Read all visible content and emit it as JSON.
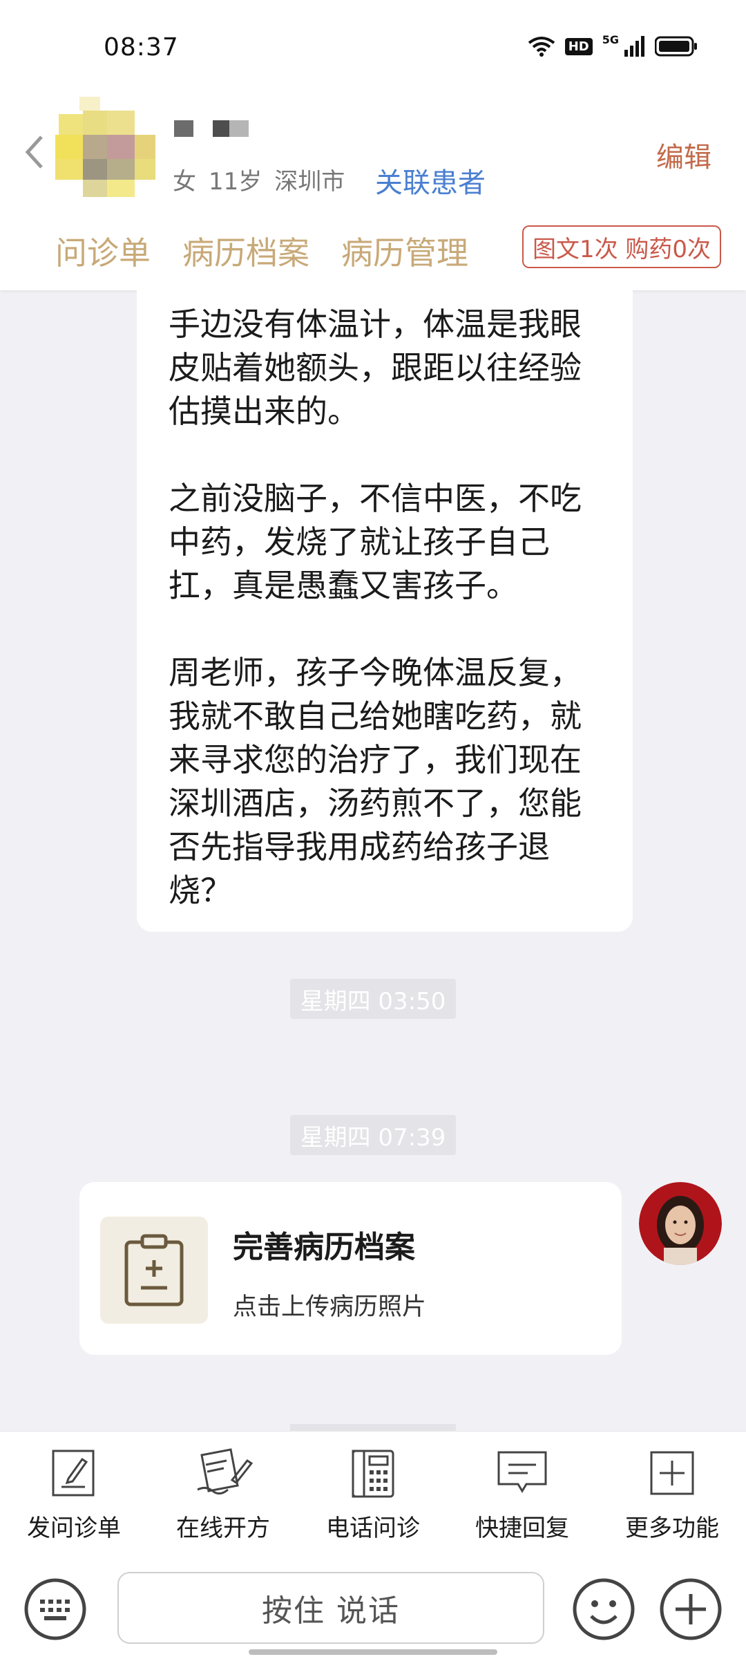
{
  "status_bar": {
    "time": "08:37",
    "hd": "HD",
    "network": "5G"
  },
  "header": {
    "gender": "女",
    "age": "11岁",
    "city": "深圳市",
    "link_patient": "关联患者",
    "edit": "编辑",
    "tabs": [
      "问诊单",
      "病历档案",
      "病历管理"
    ],
    "usage_badge": "图文1次 购药0次"
  },
  "chat": {
    "patient_message": [
      "手边没有体温计，体温是我眼皮贴着她额头，跟距以往经验估摸出来的。",
      "之前没脑子，不信中医，不吃中药，发烧了就让孩子自己扛，真是愚蠢又害孩子。",
      "周老师，孩子今晚体温反复，我就不敢自己给她瞎吃药，就来寻求您的治疗了，我们现在深圳酒店，汤药煎不了，您能否先指导我用成药给孩子退烧？"
    ],
    "timestamps": [
      "星期四 03:50",
      "星期四 07:39"
    ],
    "card": {
      "title": "完善病历档案",
      "subtitle": "点击上传病历照片"
    }
  },
  "toolbar": {
    "items": [
      {
        "label": "发问诊单",
        "icon": "form-pen-icon"
      },
      {
        "label": "在线开方",
        "icon": "prescription-icon"
      },
      {
        "label": "电话问诊",
        "icon": "phone-icon"
      },
      {
        "label": "快捷回复",
        "icon": "quick-reply-icon"
      },
      {
        "label": "更多功能",
        "icon": "more-plus-icon"
      }
    ]
  },
  "input": {
    "voice_button": "按住 说话"
  },
  "colors": {
    "accent_gold": "#c8a978",
    "link_blue": "#4a7fd1",
    "edit_red": "#c26a4a",
    "badge_red": "#c9594a"
  }
}
